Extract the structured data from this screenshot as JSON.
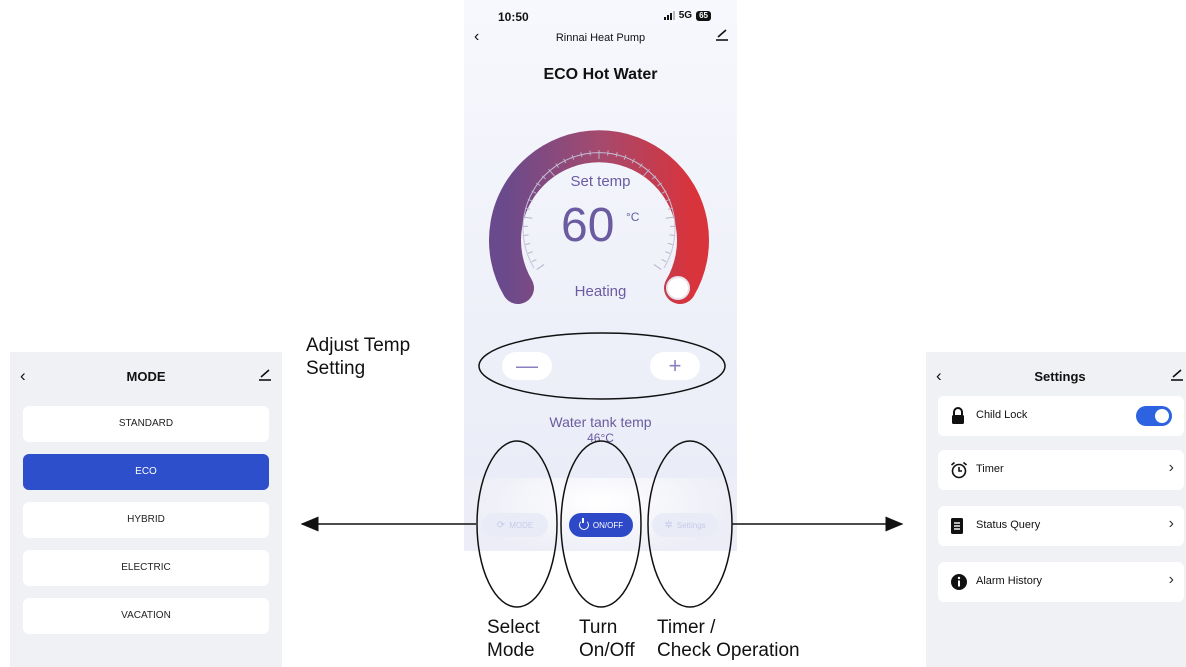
{
  "phone": {
    "status_time": "10:50",
    "status_network": "5G",
    "status_battery": "65",
    "nav_title": "Rinnai Heat Pump",
    "mode_title": "ECO  Hot Water",
    "set_label": "Set temp",
    "set_temp": "60",
    "temp_unit": "°C",
    "heating_label": "Heating",
    "minus_label": "—",
    "plus_label": "+",
    "tank_label": "Water tank temp",
    "tank_value": "46°C",
    "dock": {
      "mode_label": "MODE",
      "onoff_label": "ON/OFF",
      "settings_label": "Settings"
    },
    "dial_colors": {
      "start": "#6a4a8c",
      "mid": "#a44a6e",
      "end": "#d9333b"
    }
  },
  "mode_panel": {
    "title": "MODE",
    "options": [
      "STANDARD",
      "ECO",
      "HYBRID",
      "ELECTRIC",
      "VACATION"
    ],
    "selected": "ECO",
    "accent": "#2d4fcc"
  },
  "settings_panel": {
    "title": "Settings",
    "child_lock_label": "Child Lock",
    "child_lock_on": true,
    "timer_label": "Timer",
    "status_query_label": "Status Query",
    "alarm_history_label": "Alarm History"
  },
  "annotations": {
    "adjust_line1": "Adjust Temp",
    "adjust_line2": "Setting",
    "select_line1": "Select",
    "select_line2": "Mode",
    "turn_line1": "Turn",
    "turn_line2": "On/Off",
    "timer_line1": "Timer /",
    "timer_line2": "Check Operation"
  }
}
